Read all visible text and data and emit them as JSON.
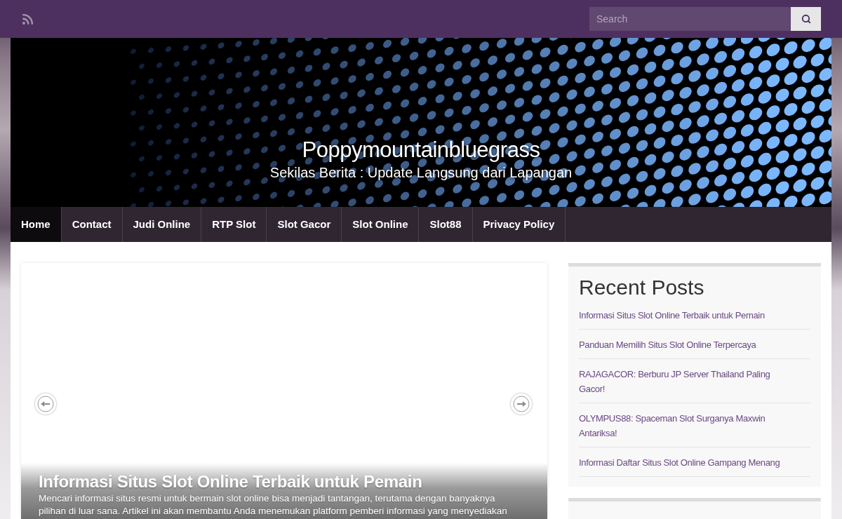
{
  "top_bar": {
    "search": {
      "placeholder": "Search"
    }
  },
  "header": {
    "site_title": "Poppymountainbluegrass",
    "tagline": "Sekilas Berita : Update Langsung dari Lapangan"
  },
  "nav": {
    "items": [
      {
        "label": "Home",
        "selected": true
      },
      {
        "label": "Contact",
        "selected": false
      },
      {
        "label": "Judi Online",
        "selected": false
      },
      {
        "label": "RTP Slot",
        "selected": false
      },
      {
        "label": "Slot Gacor",
        "selected": false
      },
      {
        "label": "Slot Online",
        "selected": false
      },
      {
        "label": "Slot88",
        "selected": false
      },
      {
        "label": "Privacy Policy",
        "selected": false
      }
    ]
  },
  "slider": {
    "title": "Informasi Situs Slot Online Terbaik untuk Pemain",
    "excerpt": "Mencari informasi situs resmi untuk bermain slot online bisa menjadi tantangan, terutama dengan banyaknya pilihan di luar sana. Artikel ini akan membantu Anda menemukan platform pemberi informasi yang menyediakan"
  },
  "sidebar": {
    "widgets": [
      {
        "title": "Recent Posts",
        "links": [
          "Informasi Situs Slot Online Terbaik untuk Pemain",
          "Panduan Memilih Situs Slot Online Terpercaya",
          "RAJAGACOR: Berburu JP Server Thailand Paling Gacor!",
          "OLYMPUS88: Spaceman Slot Surganya Maxwin Antariksa!",
          "Informasi Daftar Situs Slot Online Gampang Menang"
        ]
      }
    ]
  }
}
